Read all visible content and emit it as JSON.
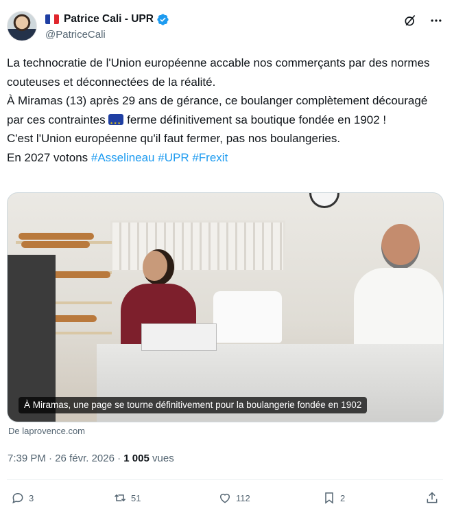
{
  "author": {
    "display_name": "Patrice Cali - UPR",
    "handle": "@PatriceCali",
    "flag_icon": "french-flag",
    "verified": true,
    "colors": {
      "verified": "#1d9bf0"
    }
  },
  "header_actions": [
    "grok-icon",
    "more-icon"
  ],
  "tweet": {
    "lines": [
      "La technocratie de l'Union européenne accable nos commerçants par des normes couteuses et déconnectées de la réalité.",
      "À Miramas (13) après 29 ans de gérance, ce boulanger complètement découragé par ces contraintes",
      "ferme définitivement sa boutique fondée en 1902 !",
      "C'est l'Union européenne qu'il faut fermer, pas nos boulangeries.",
      "En 2027 votons"
    ],
    "hashtags": [
      "#Asselineau",
      "#UPR",
      "#Frexit"
    ],
    "colors": {
      "hashtag": "#1d9bf0",
      "text": "#0f1419"
    }
  },
  "media": {
    "caption": "À Miramas, une page se tourne définitivement pour la boulangerie fondée en 1902"
  },
  "link_source": "De laprovence.com",
  "meta": {
    "time": "7:39 PM",
    "separator": "·",
    "date": "26 févr. 2026",
    "views_count": "1 005",
    "views_label": "vues"
  },
  "actions": {
    "replies": "3",
    "reposts": "51",
    "likes": "112",
    "bookmarks": "2"
  }
}
